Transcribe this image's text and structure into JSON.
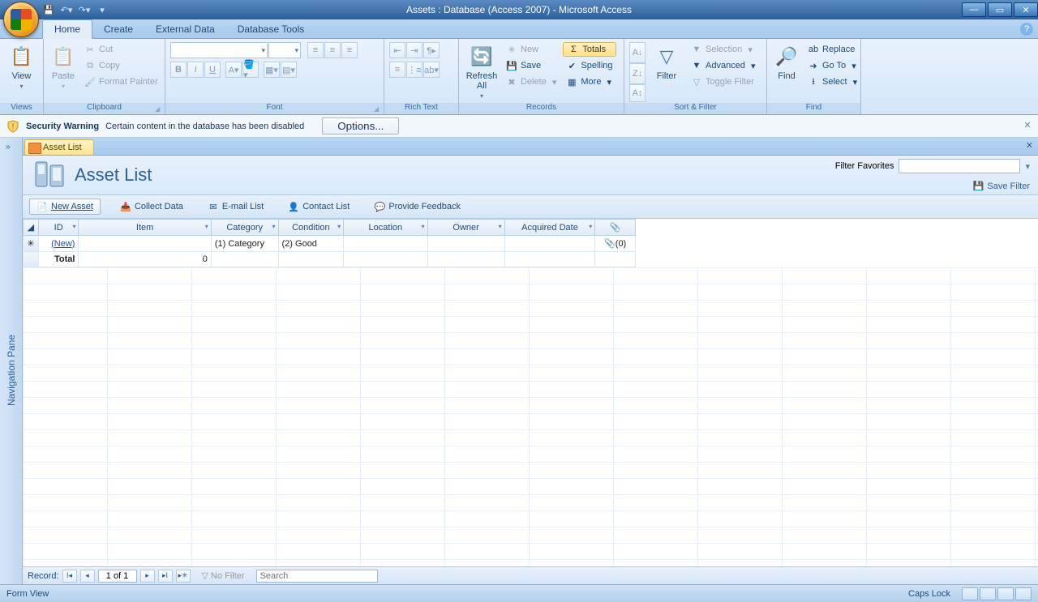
{
  "title": "Assets : Database (Access 2007) - Microsoft Access",
  "qat": {
    "save": "💾",
    "undo": "↶",
    "redo": "↷"
  },
  "tabs": [
    "Home",
    "Create",
    "External Data",
    "Database Tools"
  ],
  "ribbon": {
    "views": {
      "label": "Views",
      "view_btn": "View"
    },
    "clipboard": {
      "label": "Clipboard",
      "paste": "Paste",
      "cut": "Cut",
      "copy": "Copy",
      "painter": "Format Painter"
    },
    "font": {
      "label": "Font"
    },
    "richtext": {
      "label": "Rich Text"
    },
    "records": {
      "label": "Records",
      "refresh": "Refresh All",
      "new": "New",
      "save": "Save",
      "delete": "Delete",
      "totals": "Totals",
      "spelling": "Spelling",
      "more": "More"
    },
    "sortfilter": {
      "label": "Sort & Filter",
      "filter": "Filter",
      "selection": "Selection",
      "advanced": "Advanced",
      "toggle": "Toggle Filter"
    },
    "find": {
      "label": "Find",
      "find": "Find",
      "replace": "Replace",
      "goto": "Go To",
      "select": "Select"
    }
  },
  "security": {
    "title": "Security Warning",
    "msg": "Certain content in the database has been disabled",
    "options": "Options..."
  },
  "nav_pane": "Navigation Pane",
  "doc_tab": "Asset List",
  "form": {
    "title": "Asset List",
    "filter_label": "Filter Favorites",
    "save_filter": "Save Filter"
  },
  "toolbar": {
    "new_asset": "New Asset",
    "collect": "Collect Data",
    "email": "E-mail List",
    "contact": "Contact List",
    "feedback": "Provide Feedback"
  },
  "columns": [
    "ID",
    "Item",
    "Category",
    "Condition",
    "Location",
    "Owner",
    "Acquired Date",
    "📎"
  ],
  "rows": {
    "new_row": {
      "id": "(New)",
      "category": "(1) Category",
      "condition": "(2) Good",
      "attach": "📎(0)"
    },
    "total_row": {
      "label": "Total",
      "value": "0"
    }
  },
  "record_nav": {
    "label": "Record:",
    "position": "1 of 1",
    "nofilter": "No Filter",
    "search_ph": "Search"
  },
  "status": {
    "left": "Form View",
    "caps": "Caps Lock"
  }
}
